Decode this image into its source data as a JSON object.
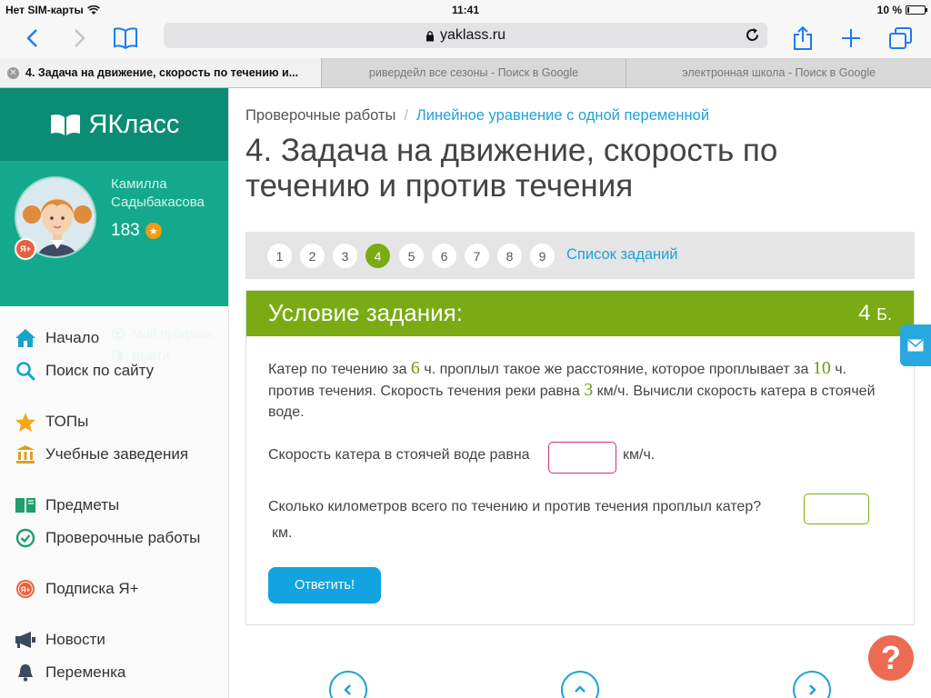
{
  "status": {
    "carrier": "Нет SIM-карты",
    "time": "11:41",
    "battery_text": "10 %",
    "battery_level": 0.1
  },
  "browser": {
    "url": "yaklass.ru",
    "tabs": [
      {
        "label": "4. Задача на движение, скорость по течению и..."
      },
      {
        "label": "ривердейл все сезоны - Поиск в Google"
      },
      {
        "label": "электронная школа - Поиск в Google"
      }
    ]
  },
  "sidebar": {
    "logo_text": "ЯКласс",
    "user": {
      "name": "Камилла Садыбакасова",
      "points": "183",
      "badge": "Я+",
      "profile_link": "Мой профиль",
      "logout_link": "Выйти"
    },
    "nav": [
      {
        "label": "Начало",
        "icon": "home-icon"
      },
      {
        "label": "Поиск по сайту",
        "icon": "search-icon"
      },
      {
        "label": "ТОПы",
        "icon": "star-icon"
      },
      {
        "label": "Учебные заведения",
        "icon": "institution-icon"
      },
      {
        "label": "Предметы",
        "icon": "books-icon"
      },
      {
        "label": "Проверочные работы",
        "icon": "check-circle-icon"
      },
      {
        "label": "Подписка Я+",
        "icon": "ya-plus-icon"
      },
      {
        "label": "Новости",
        "icon": "megaphone-icon"
      },
      {
        "label": "Переменка",
        "icon": "bell-icon"
      }
    ]
  },
  "breadcrumb": {
    "section": "Проверочные работы",
    "separator": "/",
    "topic": "Линейное уравнение с одной переменной"
  },
  "page_title": "4. Задача на движение, скорость по течению и против течения",
  "pager": {
    "pages": [
      "1",
      "2",
      "3",
      "4",
      "5",
      "6",
      "7",
      "8",
      "9"
    ],
    "current": "4",
    "list_link": "Список заданий"
  },
  "task": {
    "header": "Условие задания:",
    "points_value": "4",
    "points_unit": "Б.",
    "text": {
      "p1": "Катер по течению за ",
      "n1": "6",
      "p2": " ч. проплыл такое же расстояние, которое проплывает за ",
      "n2": "10",
      "p3": " ч. против течения. Скорость течения реки равна ",
      "n3": "3",
      "p4": " км/ч. Вычисли скорость катера в стоячей воде."
    },
    "question1": "Скорость катера в стоячей воде равна",
    "unit1": "км/ч.",
    "question2": "Сколько километров всего по течению и против течения проплыл катер?",
    "unit2": "км.",
    "submit": "Ответить!"
  },
  "help_symbol": "?"
}
